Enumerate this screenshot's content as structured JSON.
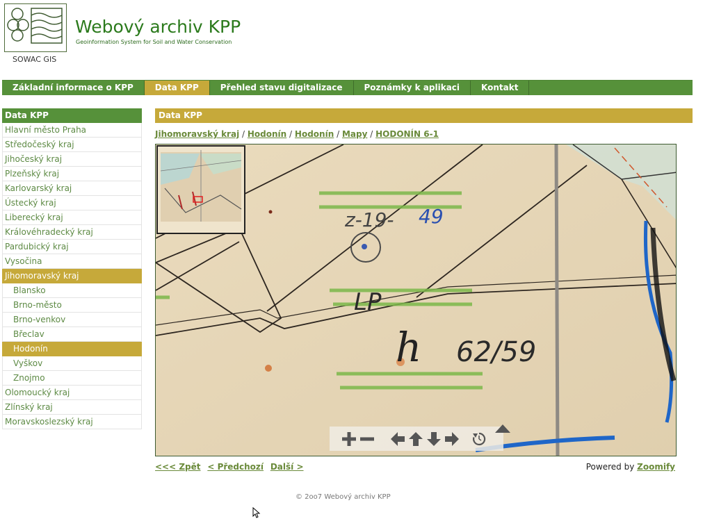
{
  "header": {
    "logo_caption": "SOWAC GIS",
    "title": "Webový archiv KPP",
    "subtitle": "Geoinformation System for Soil and Water Conservation"
  },
  "topnav": {
    "tabs": [
      {
        "label": "Základní informace o KPP",
        "active": false
      },
      {
        "label": "Data KPP",
        "active": true
      },
      {
        "label": "Přehled stavu digitalizace",
        "active": false
      },
      {
        "label": "Poznámky k aplikaci",
        "active": false
      },
      {
        "label": "Kontakt",
        "active": false
      }
    ]
  },
  "sidebar": {
    "heading": "Data KPP",
    "items": [
      {
        "label": "Hlavní město Praha",
        "level": 0,
        "active": false
      },
      {
        "label": "Středočeský kraj",
        "level": 0,
        "active": false
      },
      {
        "label": "Jihočeský kraj",
        "level": 0,
        "active": false
      },
      {
        "label": "Plzeňský kraj",
        "level": 0,
        "active": false
      },
      {
        "label": "Karlovarský kraj",
        "level": 0,
        "active": false
      },
      {
        "label": "Ústecký kraj",
        "level": 0,
        "active": false
      },
      {
        "label": "Liberecký kraj",
        "level": 0,
        "active": false
      },
      {
        "label": "Královéhradecký kraj",
        "level": 0,
        "active": false
      },
      {
        "label": "Pardubický kraj",
        "level": 0,
        "active": false
      },
      {
        "label": "Vysočina",
        "level": 0,
        "active": false
      },
      {
        "label": "Jihomoravský kraj",
        "level": 0,
        "active": true
      },
      {
        "label": "Blansko",
        "level": 1,
        "active": false
      },
      {
        "label": "Brno-město",
        "level": 1,
        "active": false
      },
      {
        "label": "Brno-venkov",
        "level": 1,
        "active": false
      },
      {
        "label": "Břeclav",
        "level": 1,
        "active": false
      },
      {
        "label": "Hodonín",
        "level": 1,
        "active": true
      },
      {
        "label": "Vyškov",
        "level": 1,
        "active": false
      },
      {
        "label": "Znojmo",
        "level": 1,
        "active": false
      },
      {
        "label": "Olomoucký kraj",
        "level": 0,
        "active": false
      },
      {
        "label": "Zlínský kraj",
        "level": 0,
        "active": false
      },
      {
        "label": "Moravskoslezský kraj",
        "level": 0,
        "active": false
      }
    ]
  },
  "main": {
    "heading": "Data KPP",
    "breadcrumb": [
      {
        "label": "Jihomoravský kraj"
      },
      {
        "label": "Hodonín"
      },
      {
        "label": "Hodonín"
      },
      {
        "label": "Mapy"
      },
      {
        "label": "HODONÍN 6-1"
      }
    ],
    "breadcrumb_separator": "/",
    "map_annotations": {
      "code": "z-19-",
      "code_blue": "49",
      "lp": "LP",
      "h": "h",
      "parcel": "62/59"
    },
    "toolbar": {
      "icons": [
        "zoom-in-icon",
        "zoom-out-icon",
        "pan-left-icon",
        "pan-up-icon",
        "pan-down-icon",
        "pan-right-icon",
        "reset-icon"
      ]
    }
  },
  "pager": {
    "back": "<<< Zpět",
    "prev": "< Předchozí",
    "next": "Další >"
  },
  "powered": {
    "prefix": "Powered by",
    "link": "Zoomify"
  },
  "footer": {
    "copyright": "© 2oo7 Webový archiv KPP"
  },
  "colors": {
    "nav_green": "#56913a",
    "active_gold": "#c6a93a",
    "link_green": "#6a8a3a",
    "map_paper": "#e6d6b8"
  }
}
